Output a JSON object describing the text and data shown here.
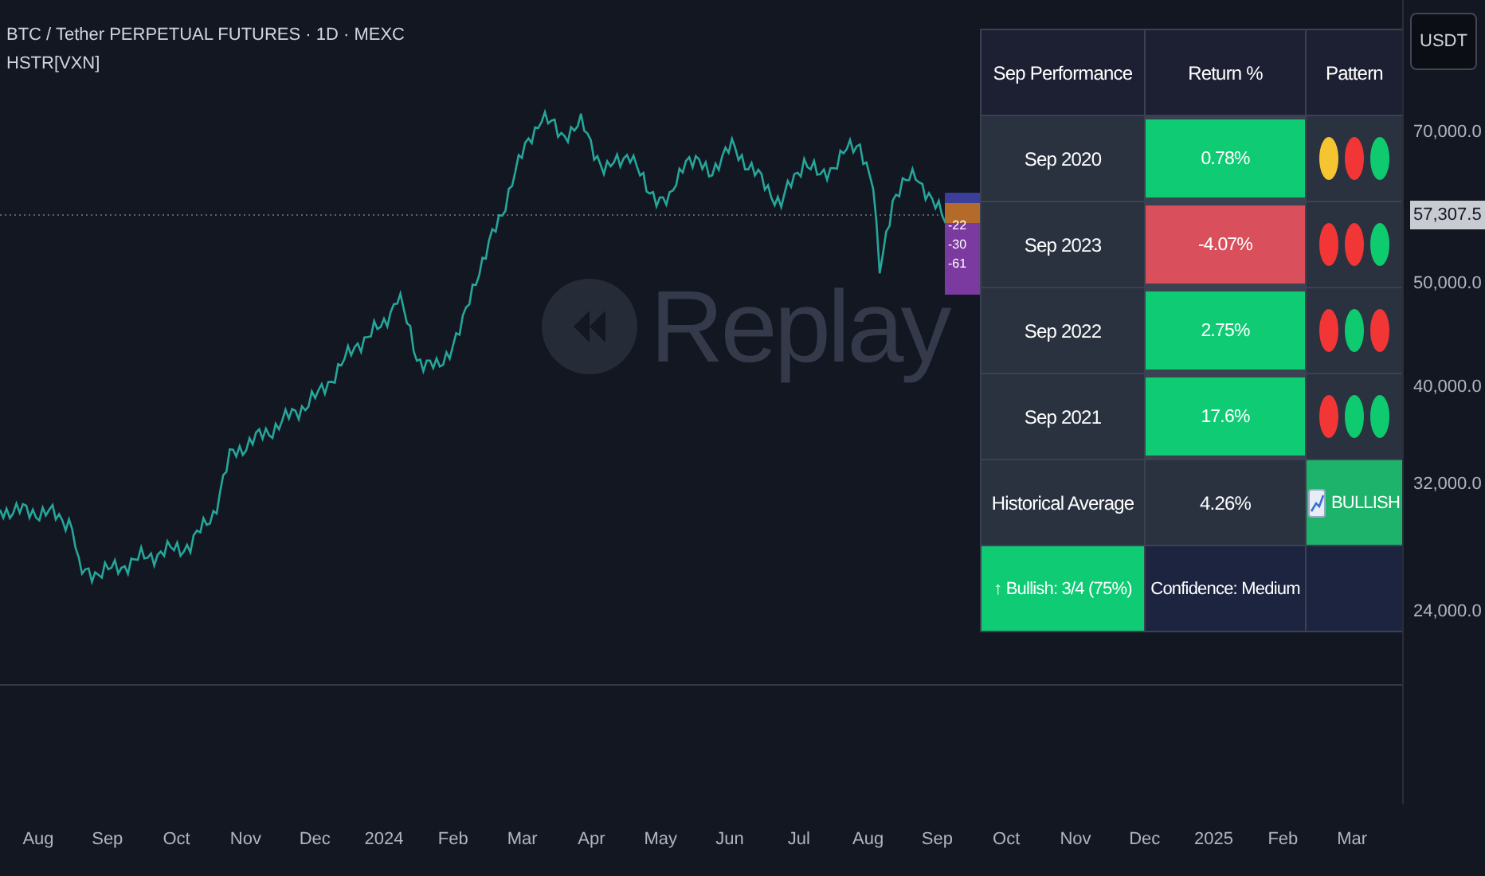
{
  "legend": {
    "symbol": "BTC / Tether PERPETUAL FUTURES · 1D · MEXC",
    "indicator": "HSTR[VXN]"
  },
  "watermark": "Replay",
  "overlay_labels": [
    "-22",
    "-30",
    "-61"
  ],
  "table": {
    "columns": [
      "Sep Performance",
      "Return %",
      "Pattern"
    ],
    "rows": [
      {
        "label": "Sep 2020",
        "value": "0.78%",
        "kind": "positive",
        "pattern": [
          {
            "color": "#f5c531"
          },
          {
            "color": "#f23535"
          },
          {
            "color": "#0ecb6f"
          }
        ]
      },
      {
        "label": "Sep 2023",
        "value": "-4.07%",
        "kind": "negative",
        "pattern": [
          {
            "color": "#f23535"
          },
          {
            "color": "#f23535"
          },
          {
            "color": "#0ecb6f"
          }
        ]
      },
      {
        "label": "Sep 2022",
        "value": "2.75%",
        "kind": "positive",
        "pattern": [
          {
            "color": "#f23535"
          },
          {
            "color": "#0ecb6f"
          },
          {
            "color": "#f23535"
          }
        ]
      },
      {
        "label": "Sep 2021",
        "value": "17.6%",
        "kind": "positive",
        "pattern": [
          {
            "color": "#f23535"
          },
          {
            "color": "#0ecb6f"
          },
          {
            "color": "#0ecb6f"
          }
        ]
      }
    ],
    "average": {
      "label": "Historical Average",
      "value": "4.26%",
      "signal": "BULLISH"
    },
    "footer": {
      "bullish": "↑ Bullish: 3/4 (75%)",
      "confidence": "Confidence: Medium"
    }
  },
  "price_axis": {
    "currency": "USDT",
    "labels": [
      "70,000.0",
      "50,000.0",
      "40,000.0",
      "32,000.0",
      "24,000.0"
    ],
    "last_price": "57,307.5"
  },
  "time_axis": [
    "Aug",
    "Sep",
    "Oct",
    "Nov",
    "Dec",
    "2024",
    "Feb",
    "Mar",
    "Apr",
    "May",
    "Jun",
    "Jul",
    "Aug",
    "Sep",
    "Oct",
    "Nov",
    "Dec",
    "2025",
    "Feb",
    "Mar"
  ]
}
